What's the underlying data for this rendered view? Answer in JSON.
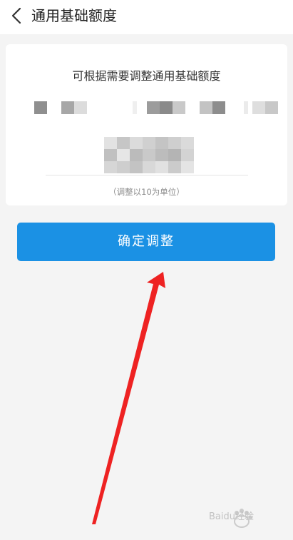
{
  "header": {
    "title": "通用基础额度",
    "back_icon": "chevron-left-icon"
  },
  "card": {
    "description": "可根据需要调整通用基础额度",
    "hint": "（调整以10为单位）"
  },
  "actions": {
    "confirm_label": "确定调整"
  },
  "colors": {
    "primary": "#1b91e4",
    "background": "#f4f4f4",
    "card": "#ffffff",
    "annotation_arrow": "#ee2222"
  },
  "watermark": {
    "text": "Baidu经验",
    "icon": "baidu-paw-icon"
  }
}
